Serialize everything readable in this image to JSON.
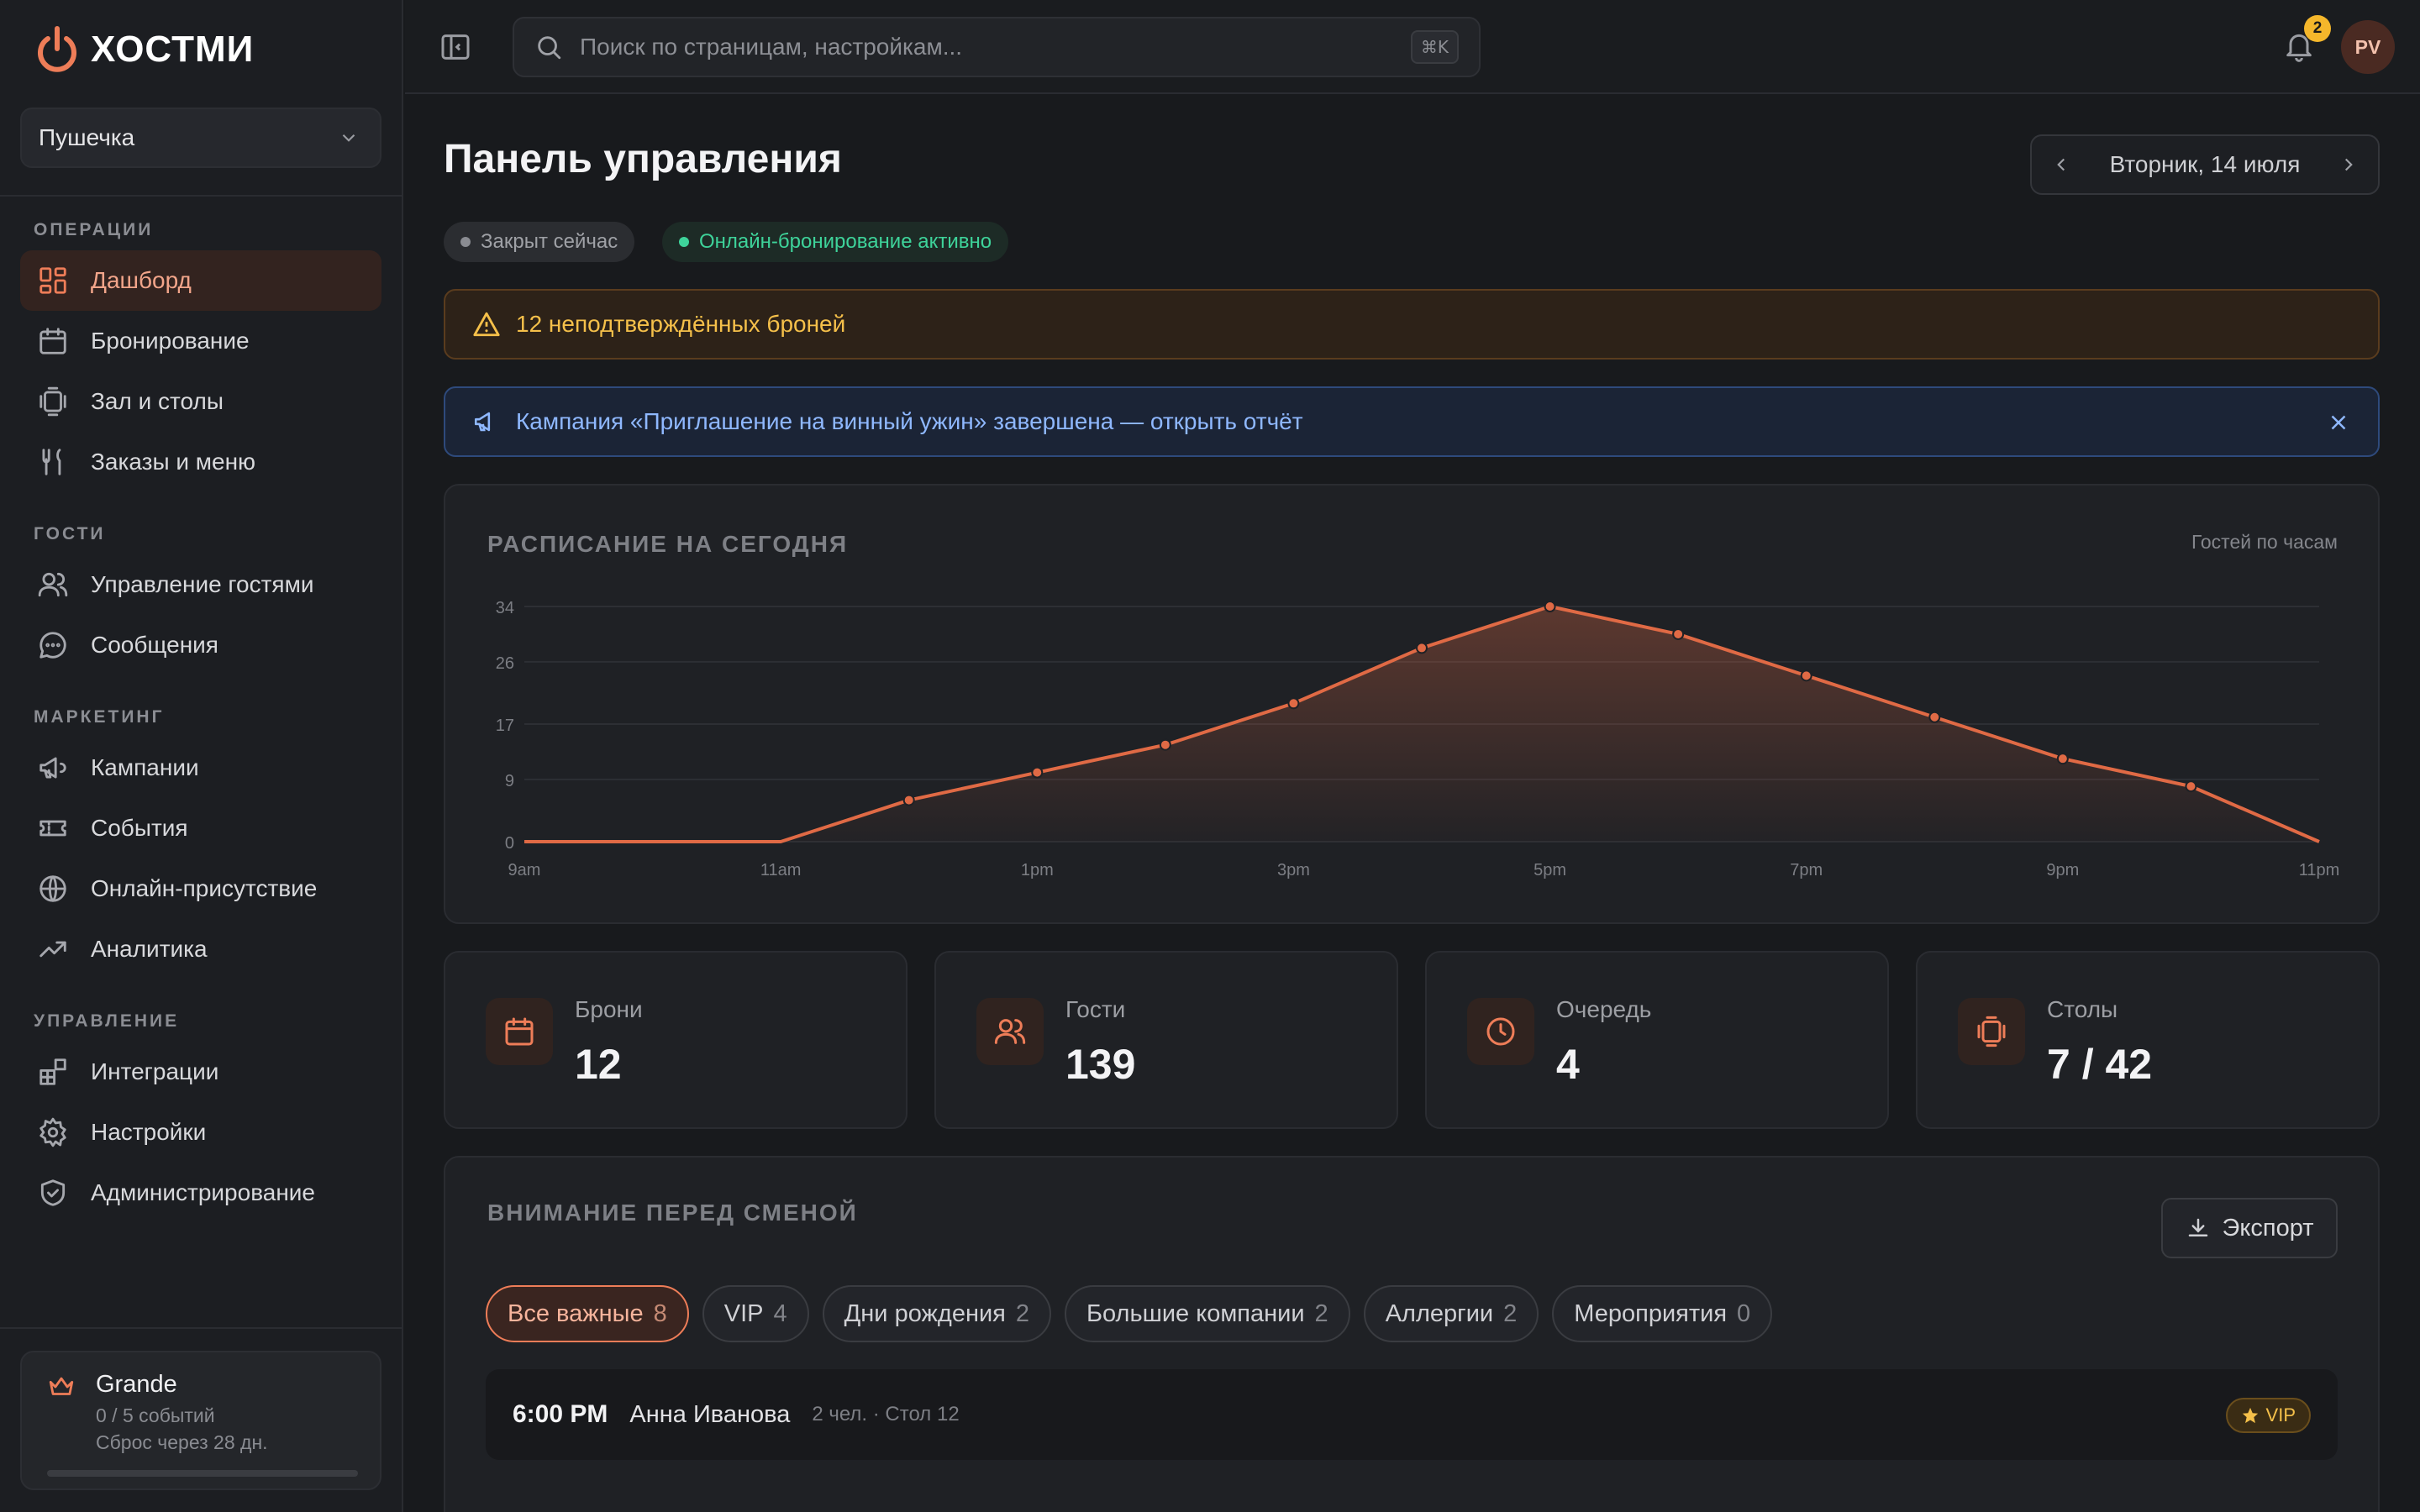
{
  "brand": {
    "name": "ХОСТМИ",
    "accent": "#ee7d58"
  },
  "venue": {
    "selected": "Пушечка"
  },
  "sidebar": {
    "sections": [
      {
        "title": "ОПЕРАЦИИ",
        "items": [
          {
            "label": "Дашборд",
            "icon": "dashboard-icon",
            "active": true
          },
          {
            "label": "Бронирование",
            "icon": "calendar-icon"
          },
          {
            "label": "Зал и столы",
            "icon": "tables-icon"
          },
          {
            "label": "Заказы и меню",
            "icon": "utensils-icon"
          }
        ]
      },
      {
        "title": "ГОСТИ",
        "items": [
          {
            "label": "Управление гостями",
            "icon": "users-icon"
          },
          {
            "label": "Сообщения",
            "icon": "chat-icon"
          }
        ]
      },
      {
        "title": "МАРКЕТИНГ",
        "items": [
          {
            "label": "Кампании",
            "icon": "megaphone-icon"
          },
          {
            "label": "События",
            "icon": "ticket-icon"
          },
          {
            "label": "Онлайн-присутствие",
            "icon": "globe-icon"
          },
          {
            "label": "Аналитика",
            "icon": "trend-icon"
          }
        ]
      },
      {
        "title": "УПРАВЛЕНИЕ",
        "items": [
          {
            "label": "Интеграции",
            "icon": "integrations-icon"
          },
          {
            "label": "Настройки",
            "icon": "gear-icon"
          },
          {
            "label": "Администрирование",
            "icon": "shield-icon"
          }
        ]
      }
    ],
    "plan": {
      "name": "Grande",
      "events": "0 / 5 событий",
      "reset": "Сброс через 28 дн.",
      "progress": 0.0
    }
  },
  "topbar": {
    "search_placeholder": "Поиск по страницам, настройкам...",
    "shortcut": "⌘K",
    "notifications_count": "2",
    "avatar_initials": "PV"
  },
  "main": {
    "title": "Панель управления",
    "date": "Вторник, 14 июля",
    "status_closed": "Закрыт сейчас",
    "status_online": "Онлайн-бронирование активно",
    "alert_warning": "12 неподтверждённых броней",
    "alert_info": "Кампания «Приглашение на винный ужин» завершена — открыть отчёт",
    "schedule_title": "РАСПИСАНИЕ НА СЕГОДНЯ",
    "schedule_subtitle": "Гостей по часам",
    "stats": [
      {
        "label": "Брони",
        "value": "12",
        "icon": "calendar-icon"
      },
      {
        "label": "Гости",
        "value": "139",
        "icon": "users-icon"
      },
      {
        "label": "Очередь",
        "value": "4",
        "icon": "clock-icon"
      },
      {
        "label": "Столы",
        "value": "7 / 42",
        "icon": "tables-icon"
      }
    ],
    "attention_title": "ВНИМАНИЕ ПЕРЕД СМЕНОЙ",
    "export_label": "Экспорт",
    "filters": [
      {
        "label": "Все важные",
        "count": "8",
        "active": true
      },
      {
        "label": "VIP",
        "count": "4"
      },
      {
        "label": "Дни рождения",
        "count": "2"
      },
      {
        "label": "Большие компании",
        "count": "2"
      },
      {
        "label": "Аллергии",
        "count": "2"
      },
      {
        "label": "Мероприятия",
        "count": "0"
      }
    ],
    "rows": [
      {
        "time": "6:00 PM",
        "name": "Анна Иванова",
        "meta": "2 чел. · Стол 12",
        "badge": "VIP"
      }
    ]
  },
  "chart_data": {
    "type": "area",
    "x": [
      "9am",
      "10am",
      "11am",
      "12pm",
      "1pm",
      "2pm",
      "3pm",
      "4pm",
      "5pm",
      "6pm",
      "7pm",
      "8pm",
      "9pm",
      "10pm",
      "11pm"
    ],
    "x_tick_labels": [
      "9am",
      "11am",
      "1pm",
      "3pm",
      "5pm",
      "7pm",
      "9pm",
      "11pm"
    ],
    "y_ticks": [
      0,
      9,
      17,
      26,
      34
    ],
    "ylim": [
      0,
      34
    ],
    "series": [
      {
        "values": [
          0,
          0,
          0,
          6,
          10,
          14,
          20,
          28,
          34,
          30,
          24,
          18,
          12,
          8,
          0
        ]
      }
    ],
    "grid": true,
    "color": "#e06a45"
  }
}
